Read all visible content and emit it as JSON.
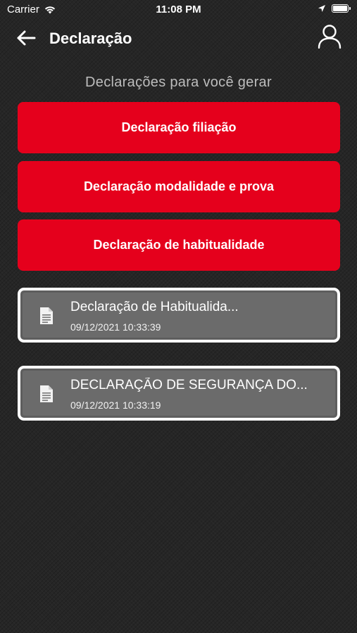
{
  "status_bar": {
    "carrier": "Carrier",
    "time": "11:08 PM"
  },
  "header": {
    "title": "Declaração",
    "back_icon": "arrow-left-icon",
    "user_icon": "user-icon"
  },
  "section": {
    "title": "Declarações para você gerar"
  },
  "actions": [
    {
      "label": "Declaração filiação",
      "color": "#e5001c"
    },
    {
      "label": "Declaração modalidade e prova",
      "color": "#e5001c"
    },
    {
      "label": "Declaração de habitualidade",
      "color": "#e5001c"
    }
  ],
  "documents": [
    {
      "title": "Declaração de Habitualida...",
      "date": "09/12/2021 10:33:39",
      "icon": "document-icon"
    },
    {
      "title": "DECLARAÇÃO DE SEGURANÇA DO...",
      "date": "09/12/2021 10:33:19",
      "icon": "document-icon"
    }
  ]
}
